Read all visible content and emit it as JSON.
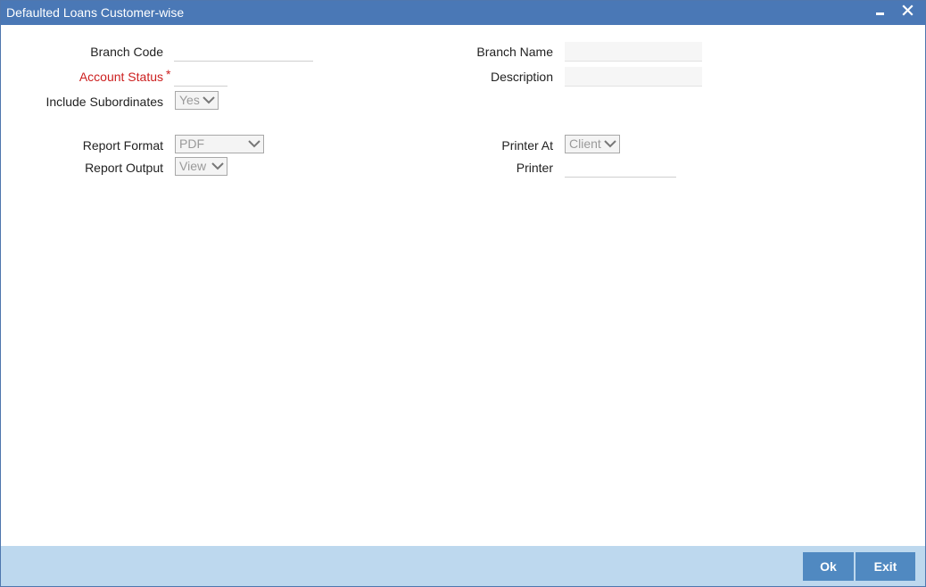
{
  "window": {
    "title": "Defaulted Loans Customer-wise"
  },
  "form": {
    "branch_code_label": "Branch Code",
    "branch_code_value": "",
    "account_status_label": "Account Status",
    "account_status_asterisk": "*",
    "account_status_value": "",
    "include_subordinates_label": "Include Subordinates",
    "include_subordinates_value": "Yes",
    "branch_name_label": "Branch Name",
    "branch_name_value": "",
    "description_label": "Description",
    "description_value": "",
    "report_format_label": "Report Format",
    "report_format_value": "PDF",
    "report_output_label": "Report Output",
    "report_output_value": "View",
    "printer_at_label": "Printer At",
    "printer_at_value": "Client",
    "printer_label": "Printer",
    "printer_value": ""
  },
  "footer": {
    "ok_label": "Ok",
    "exit_label": "Exit"
  },
  "colors": {
    "titlebar": "#4a78b6",
    "footer": "#bdd8ee",
    "button": "#5089c1",
    "required": "#cc1f1f"
  },
  "icons": {
    "minimize": "minimize-icon",
    "close": "close-icon",
    "dropdown": "chevron-down-icon"
  }
}
